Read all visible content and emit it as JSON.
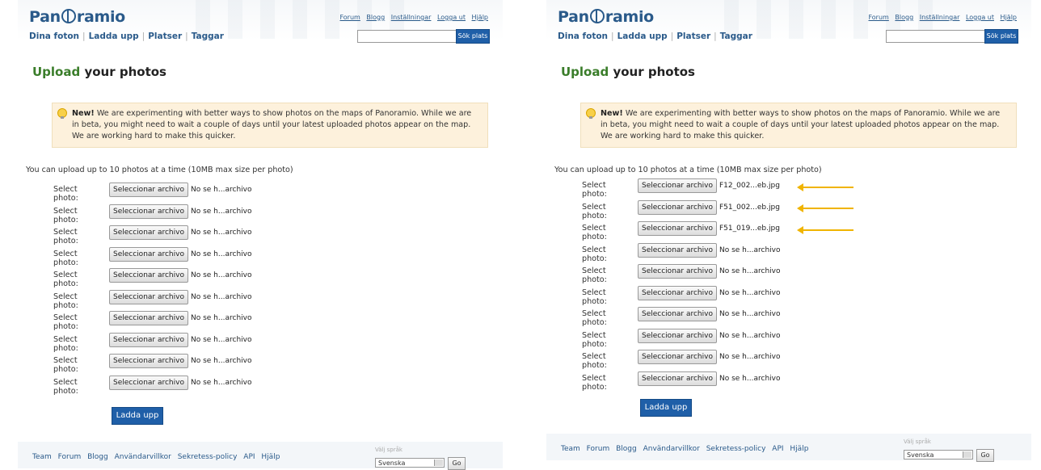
{
  "brand": "Pan⊕ramio",
  "nav": [
    "Dina foton",
    "Ladda upp",
    "Platser",
    "Taggar"
  ],
  "toplinks": [
    "Forum",
    "Blogg",
    "Inställningar",
    "Logga ut",
    "Hjälp"
  ],
  "search_button": "Sök plats",
  "title_accent": "Upload",
  "title_rest": "your photos",
  "notice": {
    "bold": "New!",
    "text": "We are experimenting with better ways to show photos on the maps of Panoramio. While we are in beta, you might need to wait a couple of days until your latest uploaded photos appear on the map. We are working hard to make this quicker."
  },
  "info": "You can upload up to 10 photos at a time (10MB max size per photo)",
  "row_label": "Select photo:",
  "file_button": "Seleccionar archivo",
  "no_file": "No se h...archivo",
  "right_selected": [
    "F12_002...eb.jpg",
    "F51_002...eb.jpg",
    "F51_019...eb.jpg"
  ],
  "submit": "Ladda upp",
  "footer_links": [
    "Team",
    "Forum",
    "Blogg",
    "Användarvillkor",
    "Sekretess-policy",
    "API",
    "Hjälp"
  ],
  "lang_label": "Välj språk",
  "lang_value": "Svenska",
  "go": "Go",
  "colors": {
    "accent": "#3a7d2a",
    "brand": "#2a5a8a",
    "button": "#1f5fa8",
    "notice_bg": "#fdf1dc",
    "arrow": "#f0b400"
  }
}
